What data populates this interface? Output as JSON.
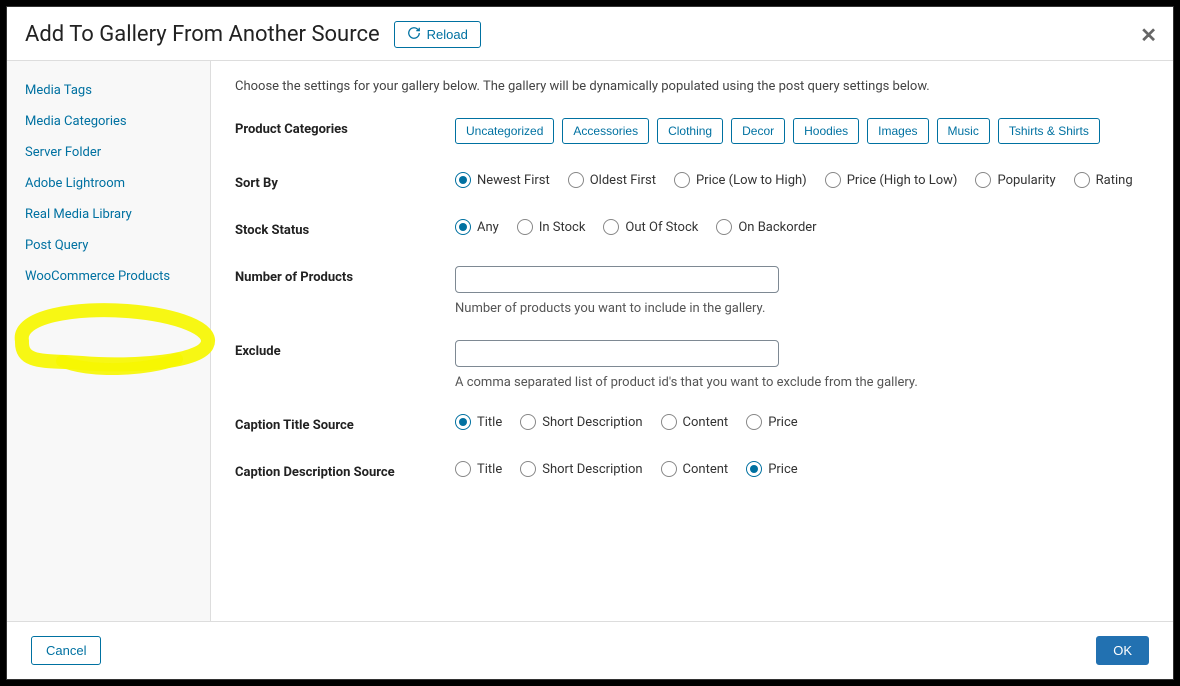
{
  "header": {
    "title": "Add To Gallery From Another Source",
    "reload_label": "Reload"
  },
  "sidebar": {
    "items": [
      {
        "label": "Media Tags"
      },
      {
        "label": "Media Categories"
      },
      {
        "label": "Server Folder"
      },
      {
        "label": "Adobe Lightroom"
      },
      {
        "label": "Real Media Library"
      },
      {
        "label": "Post Query"
      },
      {
        "label": "WooCommerce Products"
      }
    ],
    "active_index": 6
  },
  "content": {
    "intro": "Choose the settings for your gallery below. The gallery will be dynamically populated using the post query settings below.",
    "categories": {
      "label": "Product Categories",
      "options": [
        "Uncategorized",
        "Accessories",
        "Clothing",
        "Decor",
        "Hoodies",
        "Images",
        "Music",
        "Tshirts & Shirts"
      ]
    },
    "sort_by": {
      "label": "Sort By",
      "options": [
        "Newest First",
        "Oldest First",
        "Price (Low to High)",
        "Price (High to Low)",
        "Popularity",
        "Rating"
      ],
      "selected": "Newest First"
    },
    "stock_status": {
      "label": "Stock Status",
      "options": [
        "Any",
        "In Stock",
        "Out Of Stock",
        "On Backorder"
      ],
      "selected": "Any"
    },
    "number_products": {
      "label": "Number of Products",
      "value": "",
      "help": "Number of products you want to include in the gallery."
    },
    "exclude": {
      "label": "Exclude",
      "value": "",
      "help": "A comma separated list of product id's that you want to exclude from the gallery."
    },
    "caption_title": {
      "label": "Caption Title Source",
      "options": [
        "Title",
        "Short Description",
        "Content",
        "Price"
      ],
      "selected": "Title"
    },
    "caption_desc": {
      "label": "Caption Description Source",
      "options": [
        "Title",
        "Short Description",
        "Content",
        "Price"
      ],
      "selected": "Price"
    }
  },
  "footer": {
    "cancel": "Cancel",
    "ok": "OK"
  }
}
